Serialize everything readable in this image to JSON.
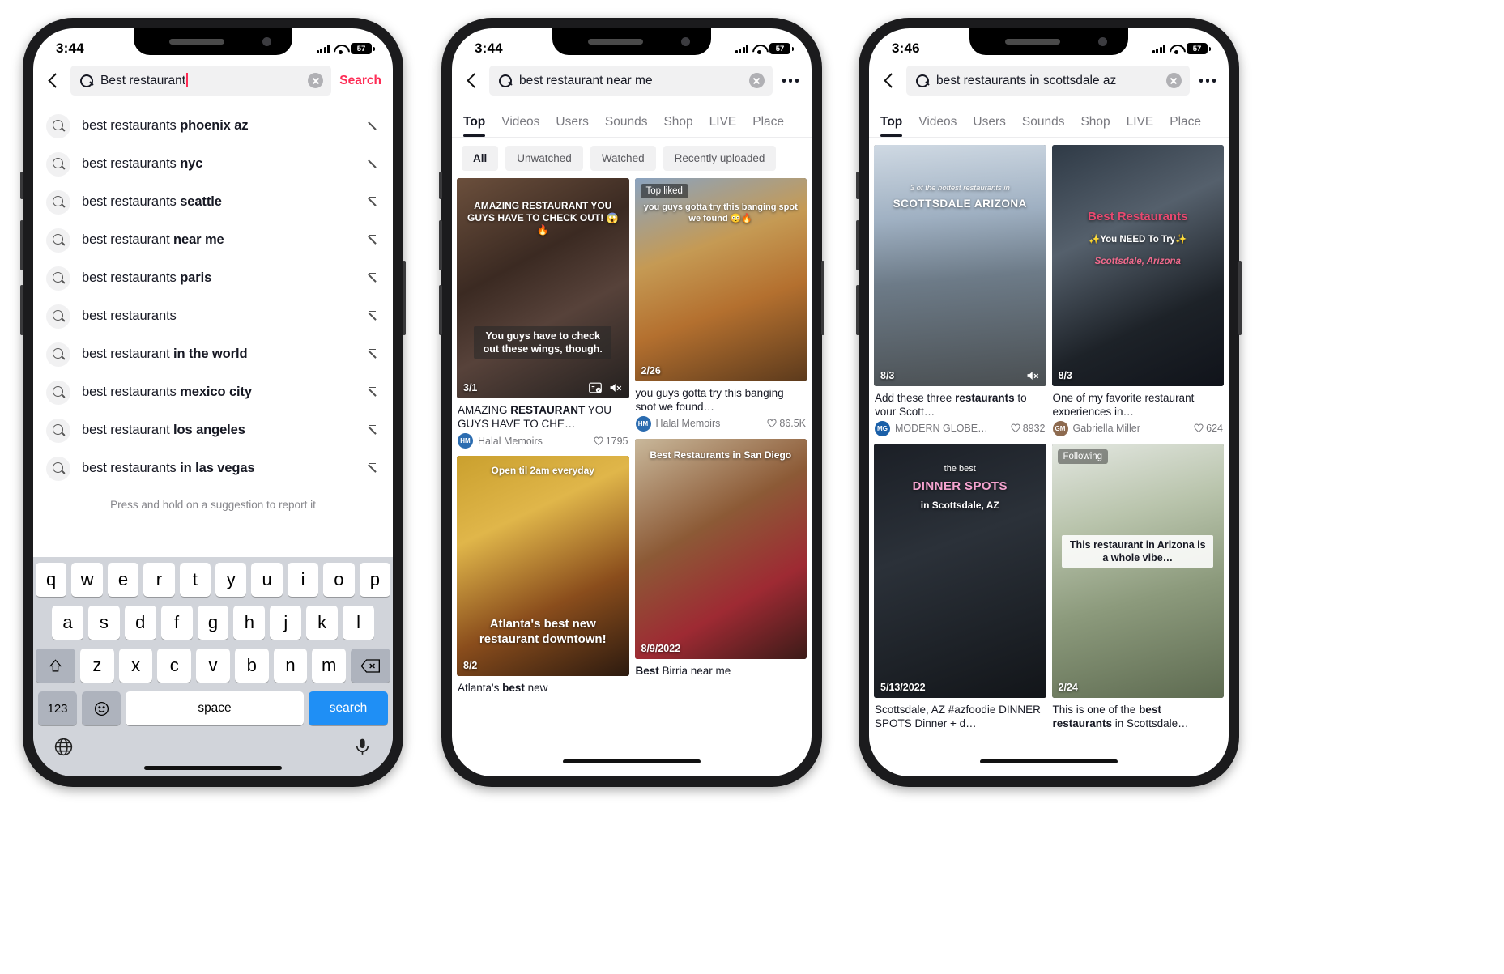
{
  "phone1": {
    "status": {
      "time": "3:44",
      "battery": "57"
    },
    "search": {
      "query": "Best restaurant",
      "search_label": "Search"
    },
    "suggestions": [
      {
        "normal": "best restaurants ",
        "bold": "phoenix az"
      },
      {
        "normal": "best restaurants ",
        "bold": "nyc"
      },
      {
        "normal": "best restaurants ",
        "bold": "seattle"
      },
      {
        "normal": "best restaurant ",
        "bold": "near me"
      },
      {
        "normal": "best restaurants ",
        "bold": "paris"
      },
      {
        "normal": "best restaurants",
        "bold": ""
      },
      {
        "normal": "best restaurant ",
        "bold": "in the world"
      },
      {
        "normal": "best restaurants ",
        "bold": "mexico city"
      },
      {
        "normal": "best restaurant ",
        "bold": "los angeles"
      },
      {
        "normal": "best restaurants ",
        "bold": "in las vegas"
      }
    ],
    "hint": "Press and hold on a suggestion to report it",
    "keyboard": {
      "row1": [
        "q",
        "w",
        "e",
        "r",
        "t",
        "y",
        "u",
        "i",
        "o",
        "p"
      ],
      "row2": [
        "a",
        "s",
        "d",
        "f",
        "g",
        "h",
        "j",
        "k",
        "l"
      ],
      "row3": [
        "z",
        "x",
        "c",
        "v",
        "b",
        "n",
        "m"
      ],
      "numbers_label": "123",
      "space_label": "space",
      "search_label": "search"
    }
  },
  "phone2": {
    "status": {
      "time": "3:44",
      "battery": "57"
    },
    "search": {
      "query": "best restaurant near me"
    },
    "tabs": [
      "Top",
      "Videos",
      "Users",
      "Sounds",
      "Shop",
      "LIVE",
      "Place"
    ],
    "active_tab": "Top",
    "chips": [
      "All",
      "Unwatched",
      "Watched",
      "Recently uploaded"
    ],
    "active_chip": "All",
    "cards": [
      {
        "overlay_top": "AMAZING RESTAURANT YOU GUYS HAVE TO CHECK OUT! 😱🔥",
        "caption_band": "You guys have to check out these wings, though.",
        "date": "3/1",
        "title_normal_1": "AMAZING ",
        "title_bold": "RESTAURANT",
        "title_normal_2": " YOU GUYS HAVE TO CHE…",
        "author": "Halal Memoirs",
        "author_initials": "HM",
        "likes": "1795",
        "muted": true
      },
      {
        "badge": "Top liked",
        "overlay_top": "you guys gotta try this banging spot we found 😳🔥",
        "date": "2/26",
        "title_normal_1": "you guys gotta try this banging spot we found…",
        "title_bold": "",
        "title_normal_2": "",
        "author": "Halal Memoirs",
        "author_initials": "HM",
        "likes": "86.5K"
      },
      {
        "overlay_top": "Open til 2am everyday",
        "overlay_bottom": "Atlanta's best new restaurant downtown!",
        "date": "8/2",
        "title_normal_1": "Atlanta's ",
        "title_bold": "best",
        "title_normal_2": " new",
        "author": "",
        "likes": ""
      },
      {
        "overlay_top": "Best Restaurants in San Diego",
        "date": "8/9/2022",
        "title_normal_1": "",
        "title_bold": "Best",
        "title_normal_2": " Birria near me",
        "author": "",
        "likes": ""
      }
    ]
  },
  "phone3": {
    "status": {
      "time": "3:46",
      "battery": "57"
    },
    "search": {
      "query": "best restaurants in scottsdale az"
    },
    "tabs": [
      "Top",
      "Videos",
      "Users",
      "Sounds",
      "Shop",
      "LIVE",
      "Place"
    ],
    "active_tab": "Top",
    "cards": [
      {
        "overlay_small": "3 of the hottest restaurants in",
        "overlay_big": "SCOTTSDALE ARIZONA",
        "date": "8/3",
        "title_normal_1": "Add these three ",
        "title_bold": "restaurants",
        "title_normal_2": " to your Scott…",
        "author": "MODERN GLOBE…",
        "author_initials": "MG",
        "likes": "8932",
        "muted": true
      },
      {
        "overlay_big": "Best Restaurants",
        "overlay_line2": "✨You NEED To Try✨",
        "overlay_line3": "Scottsdale, Arizona",
        "date": "8/3",
        "title_normal_1": "One of my favorite restaurant experiences in…",
        "title_bold": "",
        "title_normal_2": "",
        "author": "Gabriella Miller",
        "author_initials": "GM",
        "likes": "624"
      },
      {
        "overlay_small": "the best",
        "overlay_big": "DINNER SPOTS",
        "overlay_line2": "in  Scottsdale, AZ",
        "date": "5/13/2022",
        "title_normal_1": "Scottsdale, AZ #azfoodie DINNER SPOTS Dinner + d…",
        "title_bold": "",
        "title_normal_2": "",
        "author": "",
        "likes": ""
      },
      {
        "badge": "Following",
        "caption_band": "This restaurant in Arizona is a whole vibe…",
        "date": "2/24",
        "title_normal_1": "This is one of the ",
        "title_bold": "best restaurants",
        "title_normal_2": " in Scottsdale…",
        "author": "",
        "likes": ""
      }
    ]
  },
  "colors": {
    "accent": "#fe2c55",
    "text": "#161823",
    "muted": "#76767b",
    "chip_bg": "#f1f1f2",
    "keyboard_bg": "#d1d4da",
    "search_key": "#1f8ff5"
  }
}
